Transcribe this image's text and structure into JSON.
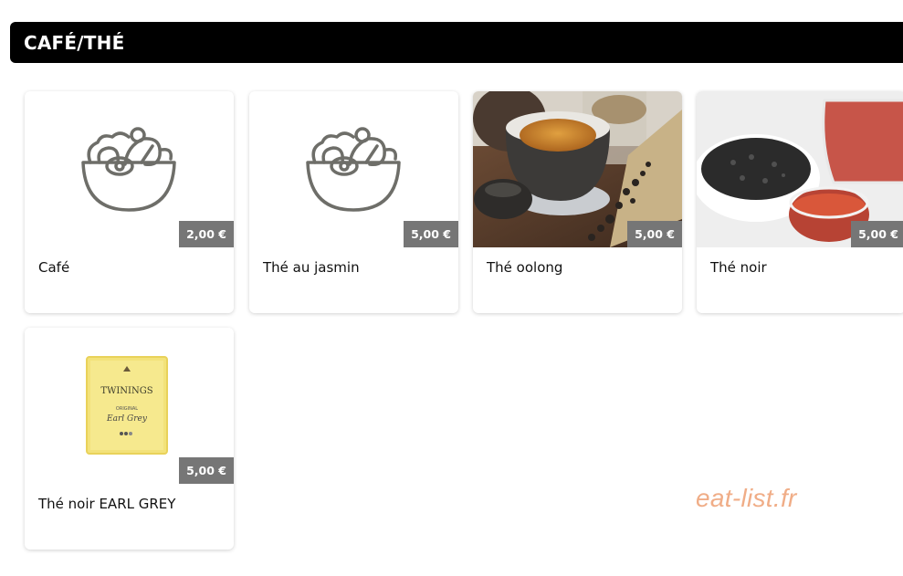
{
  "category": {
    "title": "CAFÉ/THÉ"
  },
  "products": [
    {
      "name": "Café",
      "price": "2,00 €",
      "image": "salad-bowl-icon"
    },
    {
      "name": "Thé au jasmin",
      "price": "5,00 €",
      "image": "salad-bowl-icon"
    },
    {
      "name": "Thé oolong",
      "price": "5,00 €",
      "image": "oolong-tea-photo"
    },
    {
      "name": "Thé noir",
      "price": "5,00 €",
      "image": "black-tea-photo"
    },
    {
      "name": "Thé noir EARL GREY",
      "price": "5,00 €",
      "image": "twinings-earl-grey-photo"
    }
  ],
  "earl_grey_package": {
    "brand": "TWININGS",
    "sub": "ORIGINAL",
    "flavor": "Earl Grey"
  },
  "watermark": "eat-list.fr",
  "colors": {
    "header_bg": "#000000",
    "price_bg": "#767676",
    "watermark": "#f0ad87"
  }
}
